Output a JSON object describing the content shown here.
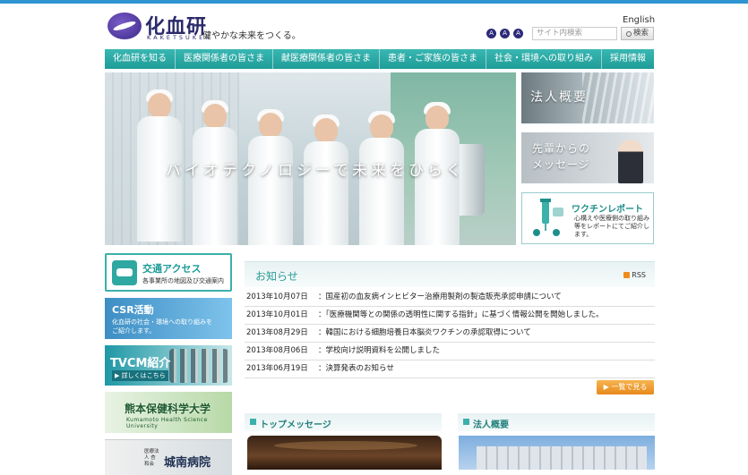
{
  "header": {
    "logo_text": "化血研",
    "logo_sub": "KAKETSUKEN",
    "tagline": "健やかな未来をつくる。",
    "english_link": "English",
    "font_sizes": [
      "A",
      "A",
      "A"
    ],
    "search_placeholder": "サイト内検索",
    "search_button": "検索"
  },
  "nav": {
    "items": [
      "化血研を知る",
      "医療関係者の皆さま",
      "献医療関係者の皆さま",
      "患者・ご家族の皆さま",
      "社会・環境への取り組み",
      "採用情報"
    ]
  },
  "hero": {
    "copy": "バイオテクノロジーで未来をひらく"
  },
  "banners": {
    "corporate": "法人概要",
    "message_line1": "先輩からの",
    "message_line2": "メッセージ",
    "vaccine_title": "ワクチンレポート",
    "vaccine_desc": "心構えや医療側の取り組み等をレポートにてご紹介します。"
  },
  "side": {
    "access_title": "交通アクセス",
    "access_sub": "各事業所の地図及び交通案内",
    "csr_title": "CSR活動",
    "csr_line1": "化血研の社会・環境への取り組みを",
    "csr_line2": "ご紹介します。",
    "tvcm_title": "TVCM紹介",
    "tvcm_sub": "▶ 詳しくはこちら",
    "kumamoto_title": "熊本保健科学大学",
    "kumamoto_sub": "Kumamoto Health Science University",
    "jonan_pre": "医療法人 杏和会",
    "jonan_title": "城南病院"
  },
  "news": {
    "title": "お知らせ",
    "rss": "RSS",
    "items": [
      {
        "date": "2013年10月07日",
        "text": "：国産初の血友病インヒビター治療用製剤の製造販売承認申請について"
      },
      {
        "date": "2013年10月01日",
        "text": "：「医療機関等との関係の透明性に関する指針」に基づく情報公開を開始しました。"
      },
      {
        "date": "2013年08月29日",
        "text": "：韓国における細胞培養日本脳炎ワクチンの承認取得について"
      },
      {
        "date": "2013年08月06日",
        "text": "：学校向け説明資料を公開しました"
      },
      {
        "date": "2013年06月19日",
        "text": "：決算発表のお知らせ"
      }
    ],
    "more": "▶ 一覧で見る"
  },
  "sections": {
    "top_message": "トップメッセージ",
    "corporate": "法人概要"
  }
}
